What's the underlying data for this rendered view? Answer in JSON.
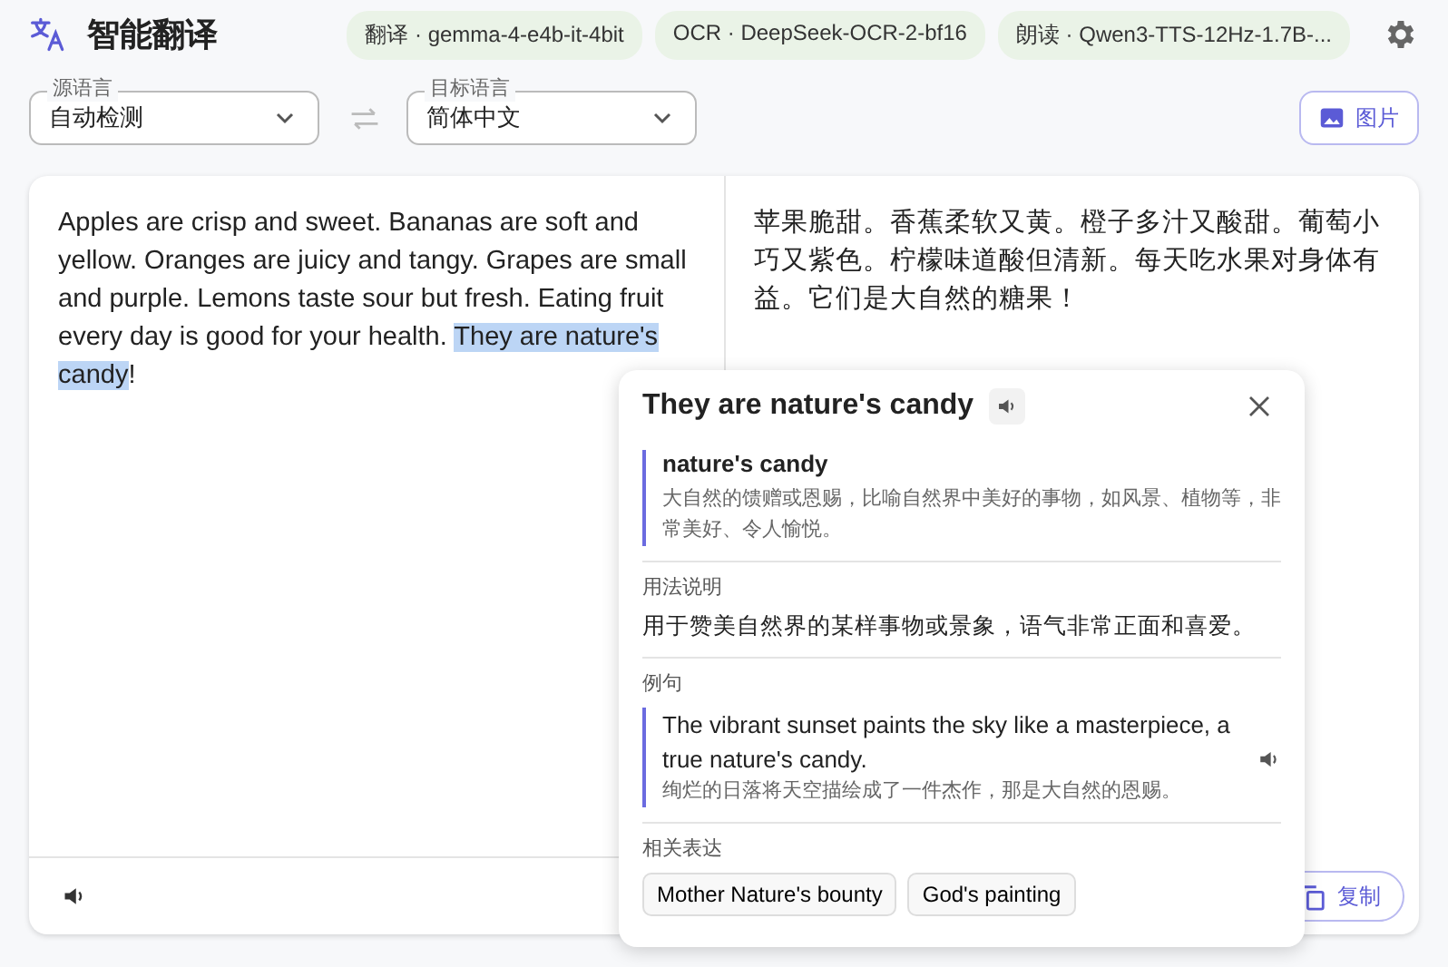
{
  "app": {
    "title": "智能翻译"
  },
  "models": [
    {
      "label": "翻译 · gemma-4-e4b-it-4bit"
    },
    {
      "label": "OCR · DeepSeek-OCR-2-bf16"
    },
    {
      "label": "朗读 · Qwen3-TTS-12Hz-1.7B-..."
    }
  ],
  "source_language": {
    "label": "源语言",
    "value": "自动检测"
  },
  "target_language": {
    "label": "目标语言",
    "value": "简体中文"
  },
  "image_button": "图片",
  "source_text": [
    {
      "text": "Apples are crisp and sweet. Bananas are soft and yellow. Oranges are juicy and tangy. Grapes are small and purple. Lemons taste sour but fresh. Eating fruit every day is good for your health. ",
      "highlighted": false
    },
    {
      "text": "They are nature's candy",
      "highlighted": true
    },
    {
      "text": "!",
      "highlighted": false
    }
  ],
  "translation": "苹果脆甜。香蕉柔软又黄。橙子多汁又酸甜。葡萄小巧又紫色。柠檬味道酸但清新。每天吃水果对身体有益。它们是大自然的糖果！",
  "copy_button": "复制",
  "popup": {
    "title": "They are nature's candy",
    "term": "nature's candy",
    "definition": "大自然的馈赠或恩赐，比喻自然界中美好的事物，如风景、植物等，非常美好、令人愉悦。",
    "usage_label": "用法说明",
    "usage": "用于赞美自然界的某样事物或景象，语气非常正面和喜爱。",
    "example_label": "例句",
    "example": "The vibrant sunset paints the sky like a masterpiece, a true nature's candy.",
    "example_translation": "绚烂的日落将天空描绘成了一件杰作，那是大自然的恩赐。",
    "related_label": "相关表达",
    "related": [
      "Mother Nature's bounty",
      "God's painting"
    ]
  }
}
